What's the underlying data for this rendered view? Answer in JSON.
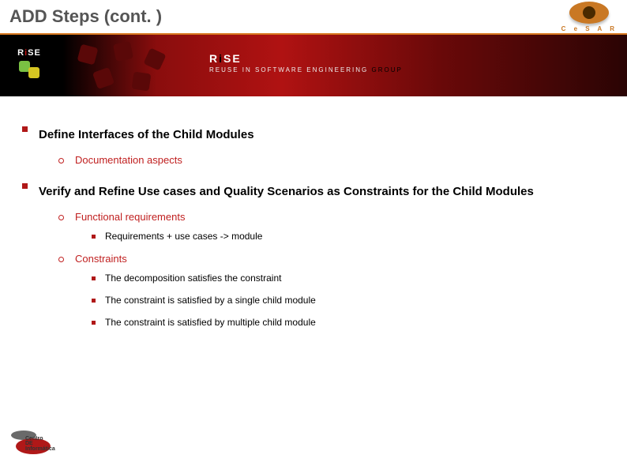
{
  "header": {
    "title": "ADD Steps (cont. )",
    "logo_text": "C e S A R"
  },
  "banner": {
    "rise": "R SE",
    "caption": "R SE",
    "subtitle_a": "REUSE IN SOFTWARE ENGINEERING ",
    "subtitle_b": "GROUP"
  },
  "content": {
    "items": [
      {
        "text": "Define Interfaces of the Child Modules",
        "children": [
          {
            "text": "Documentation aspects"
          }
        ]
      },
      {
        "text": "Verify and Refine Use cases and Quality Scenarios as Constraints for the Child Modules",
        "children": [
          {
            "text": "Functional requirements",
            "children": [
              {
                "text": "Requirements + use cases -> module"
              }
            ]
          },
          {
            "text": "Constraints",
            "children": [
              {
                "text": "The decomposition satisfies the constraint"
              },
              {
                "text": "The constraint is satisfied by a single child module"
              },
              {
                "text": "The constraint is satisfied by multiple child module"
              }
            ]
          }
        ]
      }
    ]
  },
  "footer": {
    "logo_line1": "Centro",
    "logo_line2": "DE Informática"
  }
}
